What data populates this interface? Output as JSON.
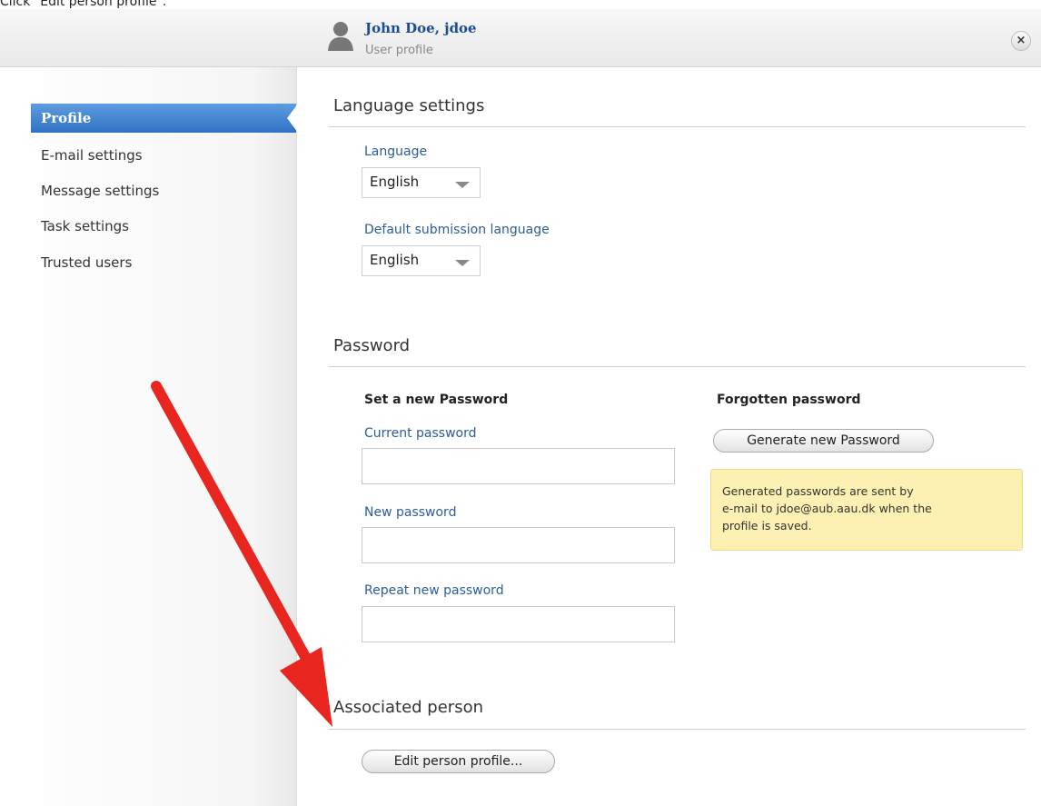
{
  "instruction": "Click \"Edit person profile\".",
  "header": {
    "title": "John Doe, jdoe",
    "subtitle": "User profile",
    "close_symbol": "×"
  },
  "sidebar": {
    "items": [
      {
        "label": "Profile",
        "active": true
      },
      {
        "label": "E-mail settings"
      },
      {
        "label": "Message settings"
      },
      {
        "label": "Task settings"
      },
      {
        "label": "Trusted users"
      }
    ]
  },
  "language": {
    "section_title": "Language settings",
    "language_label": "Language",
    "language_value": "English",
    "submission_label": "Default submission language",
    "submission_value": "English"
  },
  "password": {
    "section_title": "Password",
    "set_new_heading": "Set a new Password",
    "current_label": "Current password",
    "new_label": "New password",
    "repeat_label": "Repeat new password",
    "forgotten_heading": "Forgotten password",
    "generate_button": "Generate new Password",
    "note_line1": "Generated passwords are sent by",
    "note_line2": "e-mail to jdoe@aub.aau.dk when the",
    "note_line3": "profile is saved."
  },
  "associated": {
    "section_title": "Associated person",
    "edit_button": "Edit person profile..."
  },
  "colors": {
    "accent": "#2f72c4",
    "annotation_arrow": "#e8251f",
    "note_background": "#fdf0b3"
  },
  "icons": {
    "avatar": "user-silhouette-icon",
    "close": "close-circle-icon",
    "dropdown": "chevron-down-icon"
  }
}
